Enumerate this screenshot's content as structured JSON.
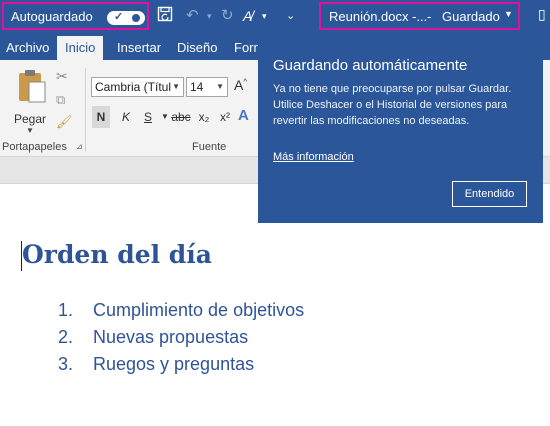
{
  "titlebar": {
    "autosave_label": "Autoguardado",
    "filename": "Reunión.docx -...",
    "separator": "-",
    "save_status": "Guardado"
  },
  "tabs": [
    "Archivo",
    "Inicio",
    "Insertar",
    "Diseño",
    "Form"
  ],
  "ribbon": {
    "paste_label": "Pegar",
    "clipboard_group": "Portapapeles",
    "font_group": "Fuente",
    "font_name": "Cambria (Títul",
    "font_size": "14",
    "bold": "N",
    "italic": "K",
    "underline": "S",
    "strikethrough": "abc",
    "subscript": "x₂",
    "superscript": "x²"
  },
  "tooltip": {
    "title": "Guardando automáticamente",
    "body": "Ya no tiene que preocuparse por pulsar Guardar. Utilice Deshacer o el Historial de versiones para revertir las modificaciones no deseadas.",
    "link": "Más información",
    "button": "Entendido"
  },
  "document": {
    "heading": "Orden del día",
    "list": [
      {
        "num": "1.",
        "text": "Cumplimiento de objetivos"
      },
      {
        "num": "2.",
        "text": "Nuevas propuestas"
      },
      {
        "num": "3.",
        "text": "Ruegos y preguntas"
      }
    ]
  },
  "colors": {
    "title_bar": "#2b579a",
    "highlight_box": "#e0129b",
    "heading_text": "#2f5496"
  }
}
